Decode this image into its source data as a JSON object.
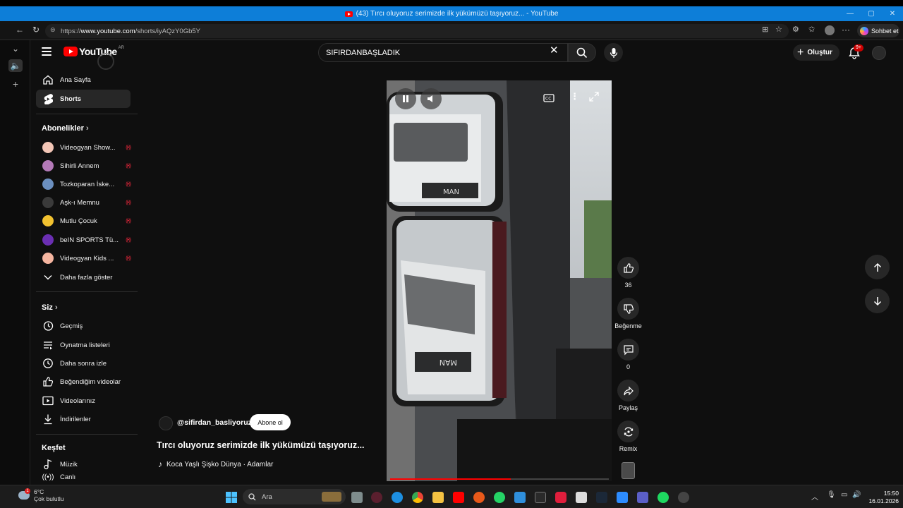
{
  "window": {
    "title": "(43) Tırcı oluyoruz serimizde ilk yükümüzü taşıyoruz... - YouTube",
    "controls": [
      "minimize-icon",
      "restore-icon",
      "close-icon"
    ]
  },
  "browser": {
    "url_prefix": "https://",
    "url_domain": "www.youtube.com",
    "url_path": "/shorts/iyAQzY0Gb5Y",
    "copilot_label": "Sohbet et"
  },
  "youtube": {
    "logo_text": "YouTube",
    "region_code": "AR",
    "search_value": "SIFIRDANBAŞLADIK",
    "create_label": "Oluştur",
    "notification_count": "9+",
    "sidebar": {
      "main": [
        {
          "label": "Ana Sayfa",
          "icon": "home-icon"
        },
        {
          "label": "Shorts",
          "icon": "shorts-icon",
          "active": true
        }
      ],
      "subscriptions_header": "Abonelikler",
      "subscriptions": [
        {
          "label": "Videogyan Show...",
          "color": "#f3c6b6"
        },
        {
          "label": "Sihirli Annem",
          "color": "#b47ab8"
        },
        {
          "label": "Tozkoparan İske...",
          "color": "#6b8fbf"
        },
        {
          "label": "Aşk-ı Memnu",
          "color": "#3a3a3a"
        },
        {
          "label": "Mutlu Çocuk",
          "color": "#f2c230"
        },
        {
          "label": "beIN SPORTS Tü...",
          "color": "#6b2fb3"
        },
        {
          "label": "Videogyan Kids ...",
          "color": "#f5b5a0"
        }
      ],
      "show_more": "Daha fazla göster",
      "you_header": "Siz",
      "you_items": [
        {
          "label": "Geçmiş",
          "icon": "history-icon"
        },
        {
          "label": "Oynatma listeleri",
          "icon": "playlist-icon"
        },
        {
          "label": "Daha sonra izle",
          "icon": "clock-icon"
        },
        {
          "label": "Beğendiğim videolar",
          "icon": "like-icon"
        },
        {
          "label": "Videolarınız",
          "icon": "your-videos-icon"
        },
        {
          "label": "İndirilenler",
          "icon": "download-icon"
        }
      ],
      "explore_header": "Keşfet",
      "explore_items": [
        {
          "label": "Müzik",
          "icon": "music-icon"
        },
        {
          "label": "Canlı",
          "icon": "live-icon"
        }
      ]
    },
    "short": {
      "channel": "@sifirdan_basliyoruz",
      "subscribe_label": "Abone ol",
      "title": "Tırcı oluyoruz serimizde ilk yükümüzü taşıyoruz...",
      "music": "Koca Yaşlı Şişko Dünya · Adamlar",
      "progress": 0.55,
      "actions": {
        "like_count": "36",
        "dislike_label": "Beğenme",
        "comment_count": "0",
        "share_label": "Paylaş",
        "remix_label": "Remix"
      }
    }
  },
  "taskbar": {
    "weather_temp": "6°C",
    "weather_desc": "Çok bulutlu",
    "weather_alert": "1",
    "search_placeholder": "Ara",
    "time": "15:50",
    "date": "16.01.2026"
  }
}
